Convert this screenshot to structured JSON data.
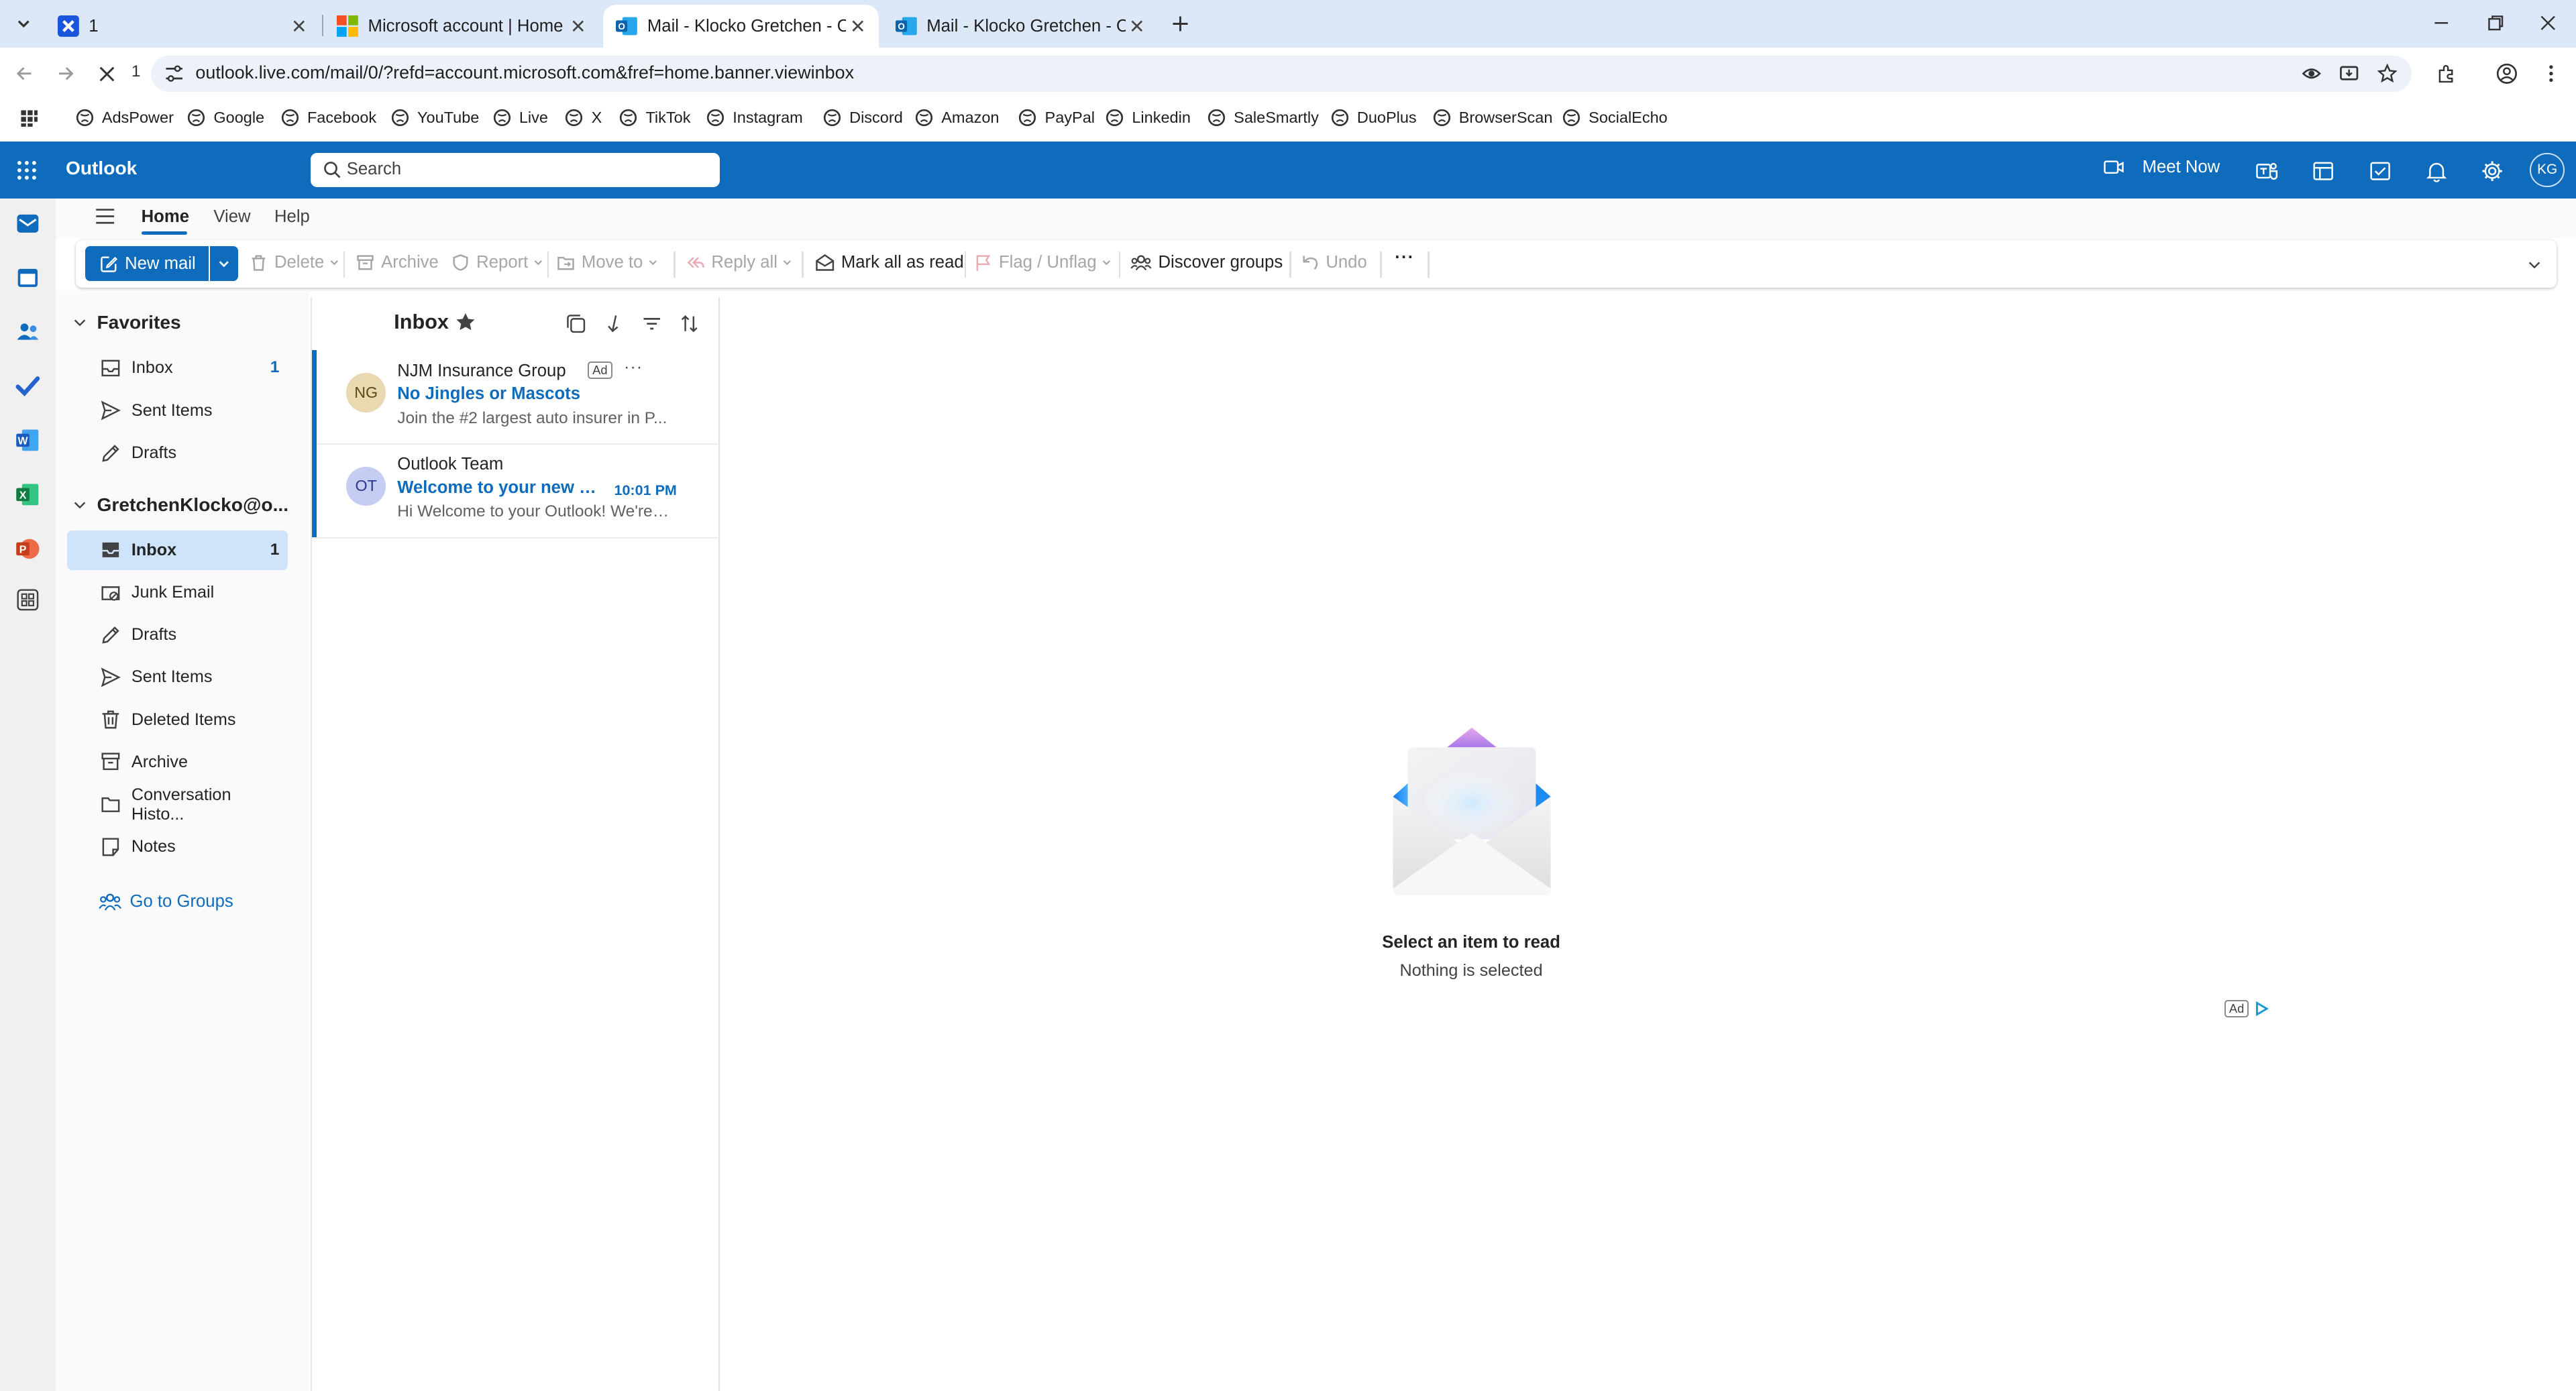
{
  "browser": {
    "tabs": [
      {
        "title": "1",
        "favicon": "blue-x-icon",
        "active": false
      },
      {
        "title": "Microsoft account | Home",
        "favicon": "microsoft-logo-icon",
        "active": false
      },
      {
        "title": "Mail - Klocko Gretchen - Out",
        "favicon": "outlook-icon",
        "active": true
      },
      {
        "title": "Mail - Klocko Gretchen - Out",
        "favicon": "outlook-icon",
        "active": false
      }
    ],
    "tab_count_label": "1",
    "url": "outlook.live.com/mail/0/?refd=account.microsoft.com&fref=home.banner.viewinbox",
    "bookmarks": [
      "AdsPower",
      "Google",
      "Facebook",
      "YouTube",
      "Live",
      "X",
      "TikTok",
      "Instagram",
      "Discord",
      "Amazon",
      "PayPal",
      "Linkedin",
      "SaleSmartly",
      "DuoPlus",
      "BrowserScan",
      "SocialEcho"
    ]
  },
  "header": {
    "app_name": "Outlook",
    "search_placeholder": "Search",
    "meet_now": "Meet Now",
    "avatar_initials": "KG",
    "brand_color": "#0f6cbd"
  },
  "ribbon": {
    "tabs": [
      "Home",
      "View",
      "Help"
    ],
    "active_tab": "Home",
    "new_mail": "New mail",
    "delete": "Delete",
    "archive": "Archive",
    "report": "Report",
    "move_to": "Move to",
    "reply_all": "Reply all",
    "mark_all_read": "Mark all as read",
    "flag_unflag": "Flag / Unflag",
    "discover_groups": "Discover groups",
    "undo": "Undo",
    "more": "···"
  },
  "folders": {
    "favorites_title": "Favorites",
    "favorites": [
      {
        "label": "Inbox",
        "count": "1",
        "icon": "inbox-icon"
      },
      {
        "label": "Sent Items",
        "count": "",
        "icon": "send-icon"
      },
      {
        "label": "Drafts",
        "count": "",
        "icon": "pencil-icon"
      }
    ],
    "account_title": "GretchenKlocko@o...",
    "account_folders": [
      {
        "label": "Inbox",
        "count": "1",
        "icon": "inbox-icon",
        "selected": true
      },
      {
        "label": "Junk Email",
        "count": "",
        "icon": "junk-icon"
      },
      {
        "label": "Drafts",
        "count": "",
        "icon": "pencil-icon"
      },
      {
        "label": "Sent Items",
        "count": "",
        "icon": "send-icon"
      },
      {
        "label": "Deleted Items",
        "count": "",
        "icon": "trash-icon"
      },
      {
        "label": "Archive",
        "count": "",
        "icon": "archive-icon"
      },
      {
        "label": "Conversation Histo...",
        "count": "",
        "icon": "folder-icon"
      },
      {
        "label": "Notes",
        "count": "",
        "icon": "note-icon"
      }
    ],
    "go_to_groups": "Go to Groups"
  },
  "message_list": {
    "title": "Inbox",
    "messages": [
      {
        "initials": "NG",
        "from": "NJM Insurance Group",
        "ad_badge": "Ad",
        "more": "···",
        "subject": "No Jingles or Mascots",
        "preview": "Join the #2 largest auto insurer in P...",
        "time": "",
        "avatar_bg": "#e8d9b0",
        "avatar_fg": "#5c4a16"
      },
      {
        "initials": "OT",
        "from": "Outlook Team",
        "ad_badge": "",
        "more": "",
        "subject": "Welcome to your new O...",
        "preview": "Hi Welcome to your Outlook! We're ...",
        "time": "10:01 PM",
        "avatar_bg": "#c5cdf2",
        "avatar_fg": "#2b3a8c"
      }
    ]
  },
  "reading_pane": {
    "title": "Select an item to read",
    "subtitle": "Nothing is selected",
    "ad_label": "Ad"
  }
}
